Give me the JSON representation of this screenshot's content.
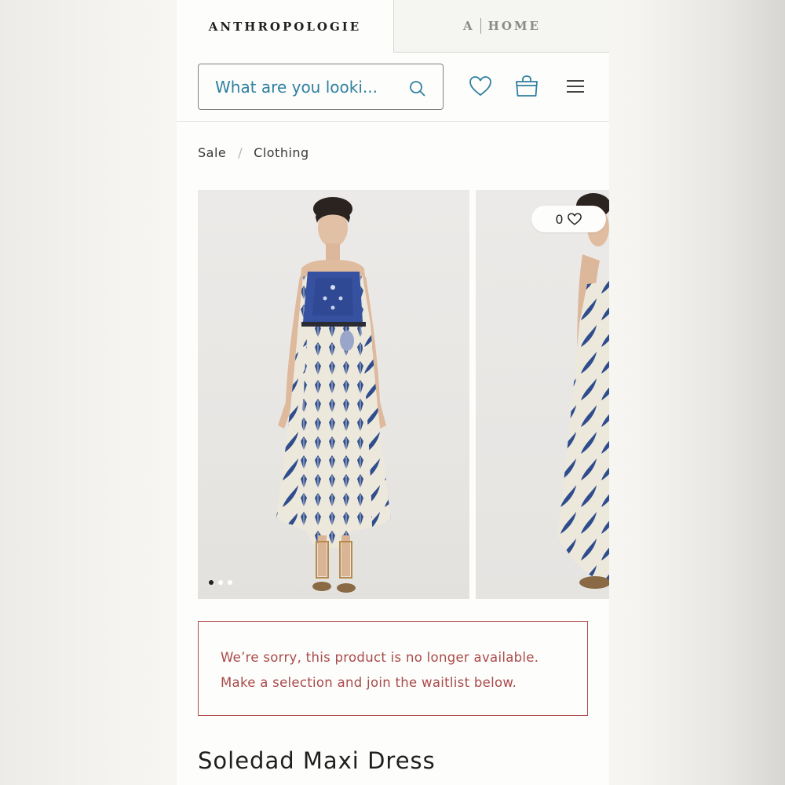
{
  "brand_tabs": {
    "primary": "ANTHROPOLOGIE",
    "home_a": "A",
    "home_label": "HOME"
  },
  "search": {
    "placeholder": "What are you looki..."
  },
  "header_icons": {
    "wishlist": "heart-icon",
    "cart": "shopping-bag-icon",
    "menu": "hamburger-menu-icon"
  },
  "breadcrumb": {
    "items": [
      "Sale",
      "Clothing"
    ],
    "separator": "/"
  },
  "gallery": {
    "favorite_count": "0",
    "dots_total": 3,
    "dots_active_index": 0
  },
  "alert": {
    "line1": "We’re sorry, this product is no longer available.",
    "line2": "Make a selection and join the waitlist below.",
    "color": "#a94a4a"
  },
  "product": {
    "title": "Soledad Maxi Dress"
  },
  "colors": {
    "accent": "#2f7fa0",
    "text": "#1f1f1f",
    "alert": "#b04a4a",
    "dress_blue": "#2f4c8c"
  }
}
